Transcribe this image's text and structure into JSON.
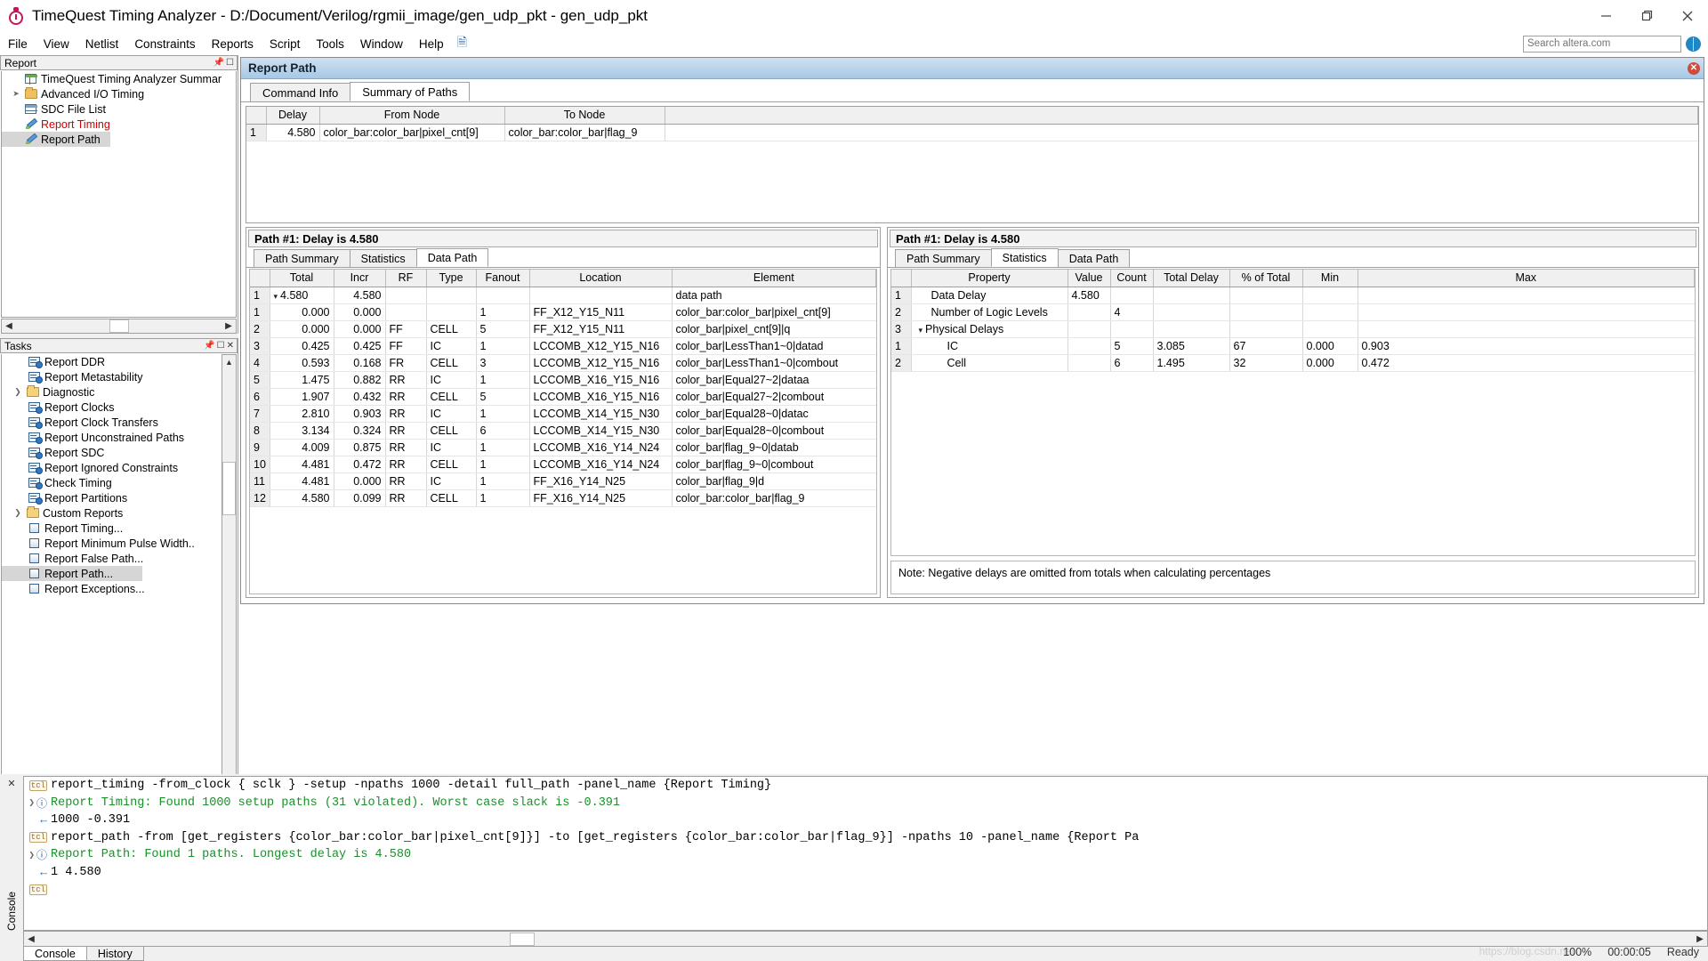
{
  "window": {
    "title": "TimeQuest Timing Analyzer - D:/Document/Verilog/rgmii_image/gen_udp_pkt - gen_udp_pkt",
    "icon": "stopwatch-icon",
    "minimize": "minimize-icon",
    "maximize": "restore-icon",
    "close": "close-icon"
  },
  "menubar": {
    "items": [
      "File",
      "View",
      "Netlist",
      "Constraints",
      "Reports",
      "Script",
      "Tools",
      "Window",
      "Help"
    ],
    "note_icon": "note-icon"
  },
  "search": {
    "placeholder": "Search altera.com",
    "value": "",
    "globe_icon": "globe-icon"
  },
  "report_panel": {
    "caption": "Report",
    "cap_buttons": [
      "pin-icon",
      "float-icon"
    ],
    "items": [
      {
        "label": "TimeQuest Timing Analyzer Summar",
        "icon": "grid-icon",
        "indent": 2,
        "twisty": "",
        "selected": false,
        "color": "#000000"
      },
      {
        "label": "Advanced I/O Timing",
        "icon": "folder-icon",
        "indent": 1,
        "twisty": "collapsed",
        "selected": false,
        "color": "#000000"
      },
      {
        "label": "SDC File List",
        "icon": "grid2-icon",
        "indent": 2,
        "twisty": "",
        "selected": false,
        "color": "#000000"
      },
      {
        "label": "Report Timing",
        "icon": "pencil-icon",
        "indent": 2,
        "twisty": "",
        "selected": false,
        "color": "#d10000"
      },
      {
        "label": "Report Path",
        "icon": "pencil-icon",
        "indent": 2,
        "twisty": "",
        "selected": true,
        "color": "#000000"
      }
    ]
  },
  "tasks_panel": {
    "caption": "Tasks",
    "cap_buttons": [
      "pin-icon",
      "float-icon",
      "close-icon"
    ],
    "items": [
      {
        "label": "Report DDR",
        "icon": "report-icon",
        "indent": 2,
        "twisty": "",
        "selected": false
      },
      {
        "label": "Report Metastability",
        "icon": "report-icon",
        "indent": 2,
        "twisty": "",
        "selected": false
      },
      {
        "label": "Diagnostic",
        "icon": "folder-open-icon",
        "indent": 1,
        "twisty": "expanded",
        "selected": false
      },
      {
        "label": "Report Clocks",
        "icon": "report-icon",
        "indent": 2,
        "twisty": "",
        "selected": false
      },
      {
        "label": "Report Clock Transfers",
        "icon": "report-icon",
        "indent": 2,
        "twisty": "",
        "selected": false
      },
      {
        "label": "Report Unconstrained Paths",
        "icon": "report-icon",
        "indent": 2,
        "twisty": "",
        "selected": false
      },
      {
        "label": "Report SDC",
        "icon": "report-icon",
        "indent": 2,
        "twisty": "",
        "selected": false
      },
      {
        "label": "Report Ignored Constraints",
        "icon": "report-icon",
        "indent": 2,
        "twisty": "",
        "selected": false
      },
      {
        "label": "Check Timing",
        "icon": "report-icon",
        "indent": 2,
        "twisty": "",
        "selected": false
      },
      {
        "label": "Report Partitions",
        "icon": "report-icon",
        "indent": 2,
        "twisty": "",
        "selected": false
      },
      {
        "label": "Custom Reports",
        "icon": "folder-open-icon",
        "indent": 1,
        "twisty": "expanded",
        "selected": false
      },
      {
        "label": "Report Timing...",
        "icon": "doc-icon",
        "indent": 2,
        "twisty": "",
        "selected": false
      },
      {
        "label": "Report Minimum Pulse Width..",
        "icon": "doc-icon",
        "indent": 2,
        "twisty": "",
        "selected": false
      },
      {
        "label": "Report False Path...",
        "icon": "doc-icon",
        "indent": 2,
        "twisty": "",
        "selected": false
      },
      {
        "label": "Report Path...",
        "icon": "doc-icon",
        "indent": 2,
        "twisty": "",
        "selected": true
      },
      {
        "label": "Report Exceptions...",
        "icon": "doc-icon",
        "indent": 2,
        "twisty": "",
        "selected": false
      }
    ]
  },
  "main_window": {
    "title": "Report Path",
    "close_icon": "close-circle-icon",
    "tabs": [
      {
        "label": "Command Info",
        "active": false
      },
      {
        "label": "Summary of Paths",
        "active": true
      }
    ],
    "summary_of_paths": {
      "columns": [
        "",
        "Delay",
        "From Node",
        "To Node"
      ],
      "rows": [
        {
          "n": "1",
          "delay": "4.580",
          "from": "color_bar:color_bar|pixel_cnt[9]",
          "to": "color_bar:color_bar|flag_9"
        }
      ]
    }
  },
  "left_pane": {
    "header": "Path #1: Delay is 4.580",
    "tabs": [
      {
        "label": "Path Summary",
        "active": false
      },
      {
        "label": "Statistics",
        "active": false
      },
      {
        "label": "Data Path",
        "active": true
      }
    ],
    "columns": [
      "",
      "Total",
      "Incr",
      "RF",
      "Type",
      "Fanout",
      "Location",
      "Element"
    ],
    "rows": [
      {
        "n": "1",
        "total": "4.580",
        "incr": "4.580",
        "rf": "",
        "type": "",
        "fanout": "",
        "location": "",
        "element": "data path",
        "chev": true
      },
      {
        "n": "1",
        "total": "0.000",
        "incr": "0.000",
        "rf": "",
        "type": "",
        "fanout": "1",
        "location": "FF_X12_Y15_N11",
        "element": "color_bar:color_bar|pixel_cnt[9]",
        "chev": false
      },
      {
        "n": "2",
        "total": "0.000",
        "incr": "0.000",
        "rf": "FF",
        "type": "CELL",
        "fanout": "5",
        "location": "FF_X12_Y15_N11",
        "element": "color_bar|pixel_cnt[9]|q",
        "chev": false
      },
      {
        "n": "3",
        "total": "0.425",
        "incr": "0.425",
        "rf": "FF",
        "type": "IC",
        "fanout": "1",
        "location": "LCCOMB_X12_Y15_N16",
        "element": "color_bar|LessThan1~0|datad",
        "chev": false
      },
      {
        "n": "4",
        "total": "0.593",
        "incr": "0.168",
        "rf": "FR",
        "type": "CELL",
        "fanout": "3",
        "location": "LCCOMB_X12_Y15_N16",
        "element": "color_bar|LessThan1~0|combout",
        "chev": false
      },
      {
        "n": "5",
        "total": "1.475",
        "incr": "0.882",
        "rf": "RR",
        "type": "IC",
        "fanout": "1",
        "location": "LCCOMB_X16_Y15_N16",
        "element": "color_bar|Equal27~2|dataa",
        "chev": false
      },
      {
        "n": "6",
        "total": "1.907",
        "incr": "0.432",
        "rf": "RR",
        "type": "CELL",
        "fanout": "5",
        "location": "LCCOMB_X16_Y15_N16",
        "element": "color_bar|Equal27~2|combout",
        "chev": false
      },
      {
        "n": "7",
        "total": "2.810",
        "incr": "0.903",
        "rf": "RR",
        "type": "IC",
        "fanout": "1",
        "location": "LCCOMB_X14_Y15_N30",
        "element": "color_bar|Equal28~0|datac",
        "chev": false
      },
      {
        "n": "8",
        "total": "3.134",
        "incr": "0.324",
        "rf": "RR",
        "type": "CELL",
        "fanout": "6",
        "location": "LCCOMB_X14_Y15_N30",
        "element": "color_bar|Equal28~0|combout",
        "chev": false
      },
      {
        "n": "9",
        "total": "4.009",
        "incr": "0.875",
        "rf": "RR",
        "type": "IC",
        "fanout": "1",
        "location": "LCCOMB_X16_Y14_N24",
        "element": "color_bar|flag_9~0|datab",
        "chev": false
      },
      {
        "n": "10",
        "total": "4.481",
        "incr": "0.472",
        "rf": "RR",
        "type": "CELL",
        "fanout": "1",
        "location": "LCCOMB_X16_Y14_N24",
        "element": "color_bar|flag_9~0|combout",
        "chev": false
      },
      {
        "n": "11",
        "total": "4.481",
        "incr": "0.000",
        "rf": "RR",
        "type": "IC",
        "fanout": "1",
        "location": "FF_X16_Y14_N25",
        "element": "color_bar|flag_9|d",
        "chev": false
      },
      {
        "n": "12",
        "total": "4.580",
        "incr": "0.099",
        "rf": "RR",
        "type": "CELL",
        "fanout": "1",
        "location": "FF_X16_Y14_N25",
        "element": "color_bar:color_bar|flag_9",
        "chev": false
      }
    ]
  },
  "right_pane": {
    "header": "Path #1: Delay is 4.580",
    "tabs": [
      {
        "label": "Path Summary",
        "active": false
      },
      {
        "label": "Statistics",
        "active": true
      },
      {
        "label": "Data Path",
        "active": false
      }
    ],
    "columns": [
      "",
      "Property",
      "Value",
      "Count",
      "Total Delay",
      "% of Total",
      "Min",
      "Max"
    ],
    "rows": [
      {
        "n": "1",
        "property": "Data Delay",
        "value": "4.580",
        "count": "",
        "total_delay": "",
        "pct": "",
        "min": "",
        "max": "",
        "chev": false,
        "sub": false
      },
      {
        "n": "2",
        "property": "Number of Logic Levels",
        "value": "",
        "count": "4",
        "total_delay": "",
        "pct": "",
        "min": "",
        "max": "",
        "chev": false,
        "sub": false
      },
      {
        "n": "3",
        "property": "Physical Delays",
        "value": "",
        "count": "",
        "total_delay": "",
        "pct": "",
        "min": "",
        "max": "",
        "chev": true,
        "sub": false
      },
      {
        "n": "1",
        "property": "IC",
        "value": "",
        "count": "5",
        "total_delay": "3.085",
        "pct": "67",
        "min": "0.000",
        "max": "0.903",
        "chev": false,
        "sub": true
      },
      {
        "n": "2",
        "property": "Cell",
        "value": "",
        "count": "6",
        "total_delay": "1.495",
        "pct": "32",
        "min": "0.000",
        "max": "0.472",
        "chev": false,
        "sub": true
      }
    ],
    "note": "Note: Negative delays are omitted from totals when calculating percentages"
  },
  "console": {
    "vertical_label": "Console",
    "close_icon": "close-icon",
    "lines": [
      {
        "gutter": "tcl",
        "text": "report_timing -from_clock { sclk } -setup -npaths 1000 -detail full_path -panel_name {Report Timing}",
        "color": "black"
      },
      {
        "gutter": "info",
        "text": "Report Timing: Found 1000 setup paths (31 violated).  Worst case slack is -0.391",
        "color": "green"
      },
      {
        "gutter": "back",
        "text": "1000 -0.391",
        "color": "black"
      },
      {
        "gutter": "tcl",
        "text": "report_path -from [get_registers {color_bar:color_bar|pixel_cnt[9]}] -to [get_registers {color_bar:color_bar|flag_9}] -npaths 10 -panel_name {Report Pa",
        "color": "black"
      },
      {
        "gutter": "info",
        "text": "Report Path: Found 1 paths. Longest delay is 4.580",
        "color": "green"
      },
      {
        "gutter": "back",
        "text": "1 4.580",
        "color": "black"
      },
      {
        "gutter": "tcl",
        "text": "",
        "color": "black"
      }
    ],
    "tabs": [
      {
        "label": "Console",
        "active": true
      },
      {
        "label": "History",
        "active": false
      }
    ]
  },
  "statusbar": {
    "zoom": "100%",
    "elapsed": "00:00:05",
    "state": "Ready",
    "watermark": "https://blog.csdn.net"
  }
}
